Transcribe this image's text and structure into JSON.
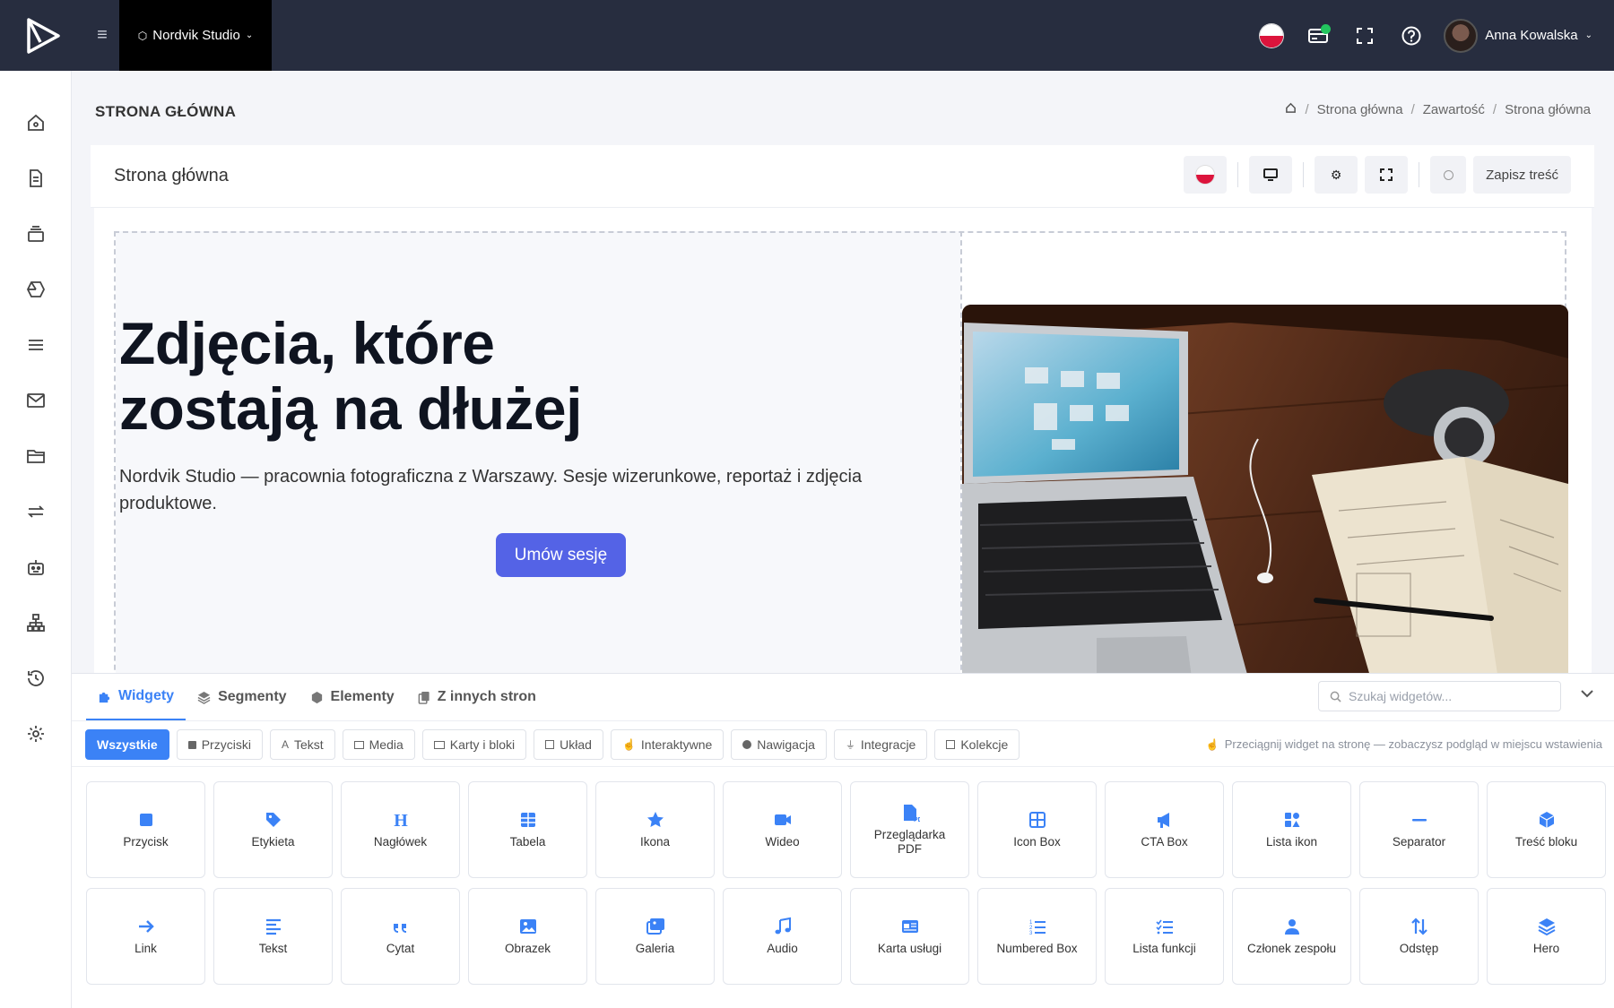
{
  "topbar": {
    "site_name": "Nordvik Studio",
    "user_name": "Anna Kowalska"
  },
  "page": {
    "title": "STRONA GŁÓWNA",
    "breadcrumb": [
      "Strona główna",
      "Zawartość",
      "Strona główna"
    ]
  },
  "editor": {
    "title": "Strona główna",
    "save_label": "Zapisz treść"
  },
  "hero": {
    "heading_line1": "Zdjęcia, które",
    "heading_line2": "zostają na dłużej",
    "lead": "Nordvik Studio — pracownia fotograficzna z Warszawy. Sesje wizerunkowe, reportaż i zdjęcia produktowe.",
    "cta": "Umów sesję"
  },
  "panel": {
    "tabs": [
      "Widgety",
      "Segmenty",
      "Elementy",
      "Z innych stron"
    ],
    "search_placeholder": "Szukaj widgetów...",
    "filters": [
      "Wszystkie",
      "Przyciski",
      "Tekst",
      "Media",
      "Karty i bloki",
      "Układ",
      "Interaktywne",
      "Nawigacja",
      "Integracje",
      "Kolekcje"
    ],
    "hint": "Przeciągnij widget na stronę — zobaczysz podgląd w miejscu wstawienia",
    "widgets": [
      {
        "label": "Przycisk",
        "icon": "square-icon"
      },
      {
        "label": "Etykieta",
        "icon": "tag-icon"
      },
      {
        "label": "Nagłówek",
        "icon": "heading-icon"
      },
      {
        "label": "Tabela",
        "icon": "table-icon"
      },
      {
        "label": "Ikona",
        "icon": "star-icon"
      },
      {
        "label": "Wideo",
        "icon": "video-icon"
      },
      {
        "label": "Przeglądarka PDF",
        "icon": "pdf-icon"
      },
      {
        "label": "Icon Box",
        "icon": "grid-box-icon"
      },
      {
        "label": "CTA Box",
        "icon": "megaphone-icon"
      },
      {
        "label": "Lista ikon",
        "icon": "icons-icon"
      },
      {
        "label": "Separator",
        "icon": "minus-icon"
      },
      {
        "label": "Treść bloku",
        "icon": "cube-icon"
      },
      {
        "label": "Link",
        "icon": "arrow-right-icon"
      },
      {
        "label": "Tekst",
        "icon": "align-left-icon"
      },
      {
        "label": "Cytat",
        "icon": "quote-icon"
      },
      {
        "label": "Obrazek",
        "icon": "image-icon"
      },
      {
        "label": "Galeria",
        "icon": "images-icon"
      },
      {
        "label": "Audio",
        "icon": "music-icon"
      },
      {
        "label": "Karta usługi",
        "icon": "card-icon"
      },
      {
        "label": "Numbered Box",
        "icon": "list-ol-icon"
      },
      {
        "label": "Lista funkcji",
        "icon": "list-check-icon"
      },
      {
        "label": "Członek zespołu",
        "icon": "user-icon"
      },
      {
        "label": "Odstęp",
        "icon": "updown-icon"
      },
      {
        "label": "Hero",
        "icon": "layers-icon"
      }
    ]
  },
  "colors": {
    "accent": "#3b82f6",
    "cta": "#5463e6",
    "topbar": "#272d3f"
  }
}
